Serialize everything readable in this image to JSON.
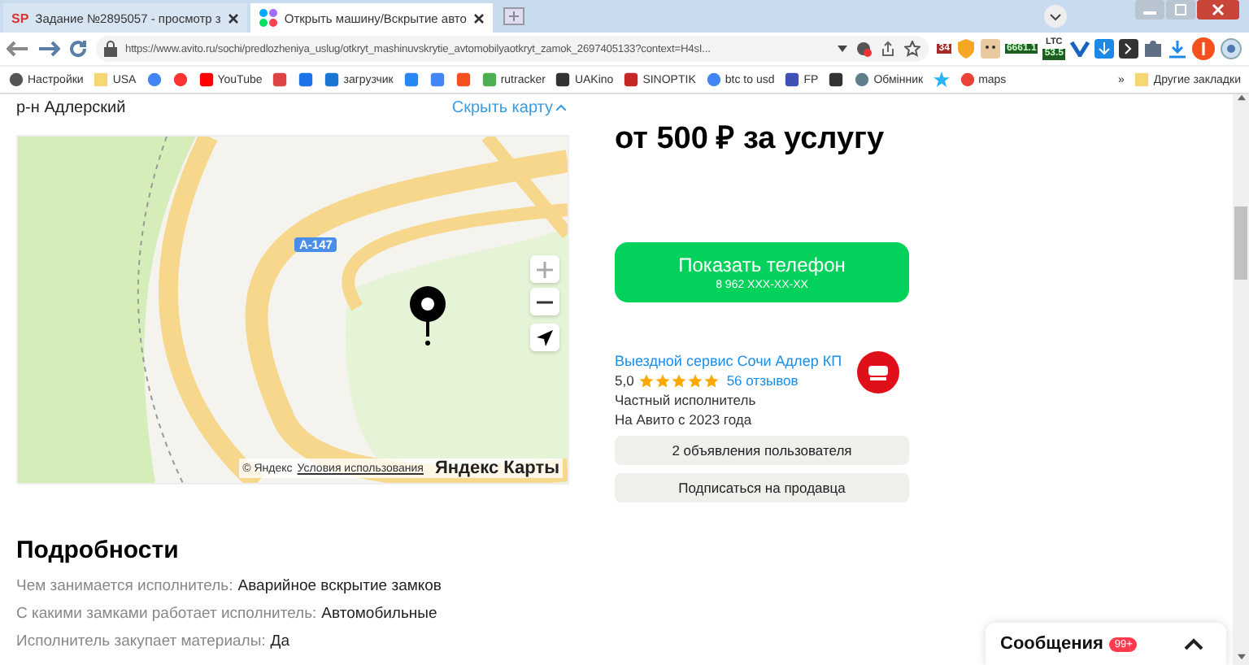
{
  "browser": {
    "tabs": [
      {
        "title": "Задание №2895057 - просмотр з",
        "icon": "SP",
        "selected": false
      },
      {
        "title": "Открыть машину/Вскрытие авто",
        "selected": true
      }
    ],
    "url": "https://www.avito.ru/sochi/predlozheniya_uslug/otkryt_mashinuvskrytie_avtomobilyaotkryt_zamok_2697405133?context=H4sI...",
    "extension_badges": [
      "34",
      "6661.1",
      "LTC",
      "53.5"
    ],
    "bookmarks": [
      {
        "label": "Настройки",
        "kind": "gear"
      },
      {
        "label": "USA",
        "kind": "folder"
      },
      {
        "kind": "g"
      },
      {
        "kind": "ya"
      },
      {
        "label": "YouTube",
        "kind": "yt"
      },
      {
        "kind": "mail"
      },
      {
        "kind": "drive"
      },
      {
        "label": "загрузчик",
        "kind": "loop"
      },
      {
        "kind": "vk"
      },
      {
        "kind": "translate"
      },
      {
        "kind": "f"
      },
      {
        "label": "rutracker",
        "kind": "flower"
      },
      {
        "label": "UAKino",
        "kind": "film"
      },
      {
        "label": "SINOPTIK",
        "kind": "thermo"
      },
      {
        "label": "btc to usd",
        "kind": "g"
      },
      {
        "label": "FP",
        "kind": "chevron"
      },
      {
        "kind": "bc"
      },
      {
        "label": "Обмінник",
        "kind": "eye"
      },
      {
        "kind": "star"
      },
      {
        "label": "maps",
        "kind": "pin"
      }
    ],
    "more": "»",
    "other_bookmarks": "Другие закладки"
  },
  "location": {
    "district": "р-н Адлерский",
    "hide_map": "Скрыть карту",
    "road_label": "А-147",
    "copyright": "© Яндекс",
    "terms": "Условия использования",
    "brand": "Яндекс Карты"
  },
  "offer": {
    "price": "от 500 ₽ за услугу",
    "phone_button": "Показать телефон",
    "phone": "8 962 XXX-XX-XX"
  },
  "seller": {
    "name": "Выездной сервис Сочи Адлер КП",
    "rating": "5,0",
    "stars": 5,
    "reviews": "56 отзывов",
    "type": "Частный исполнитель",
    "since": "На Авито с 2023 года",
    "buttons": [
      "2 объявления пользователя",
      "Подписаться на продавца"
    ]
  },
  "details": {
    "title": "Подробности",
    "rows": [
      {
        "label": "Чем занимается исполнитель:",
        "value": "Аварийное вскрытие замков"
      },
      {
        "label": "С какими замками работает исполнитель:",
        "value": "Автомобильные"
      },
      {
        "label": "Исполнитель закупает материалы:",
        "value": "Да"
      }
    ]
  },
  "messages": {
    "title": "Сообщения",
    "badge": "99+"
  }
}
